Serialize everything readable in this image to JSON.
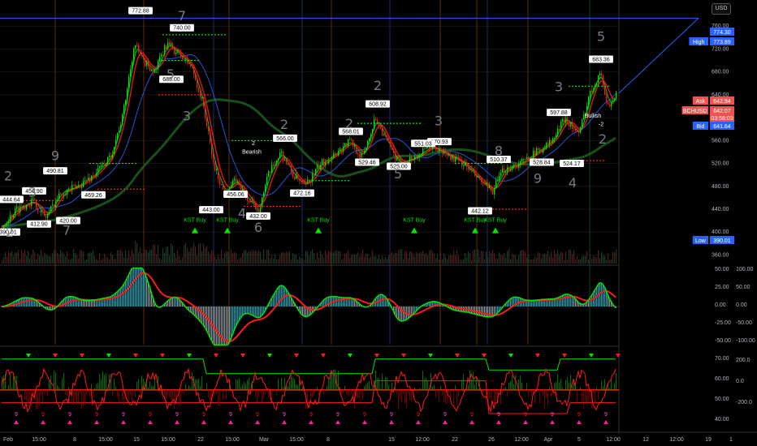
{
  "currency_button": "USD",
  "colors": {
    "bg": "#000000",
    "up": "#26a69a",
    "down": "#ef5350",
    "green": "#00e600",
    "red": "#ff1a1a",
    "blue": "#2962ff",
    "text": "#b2b5be"
  },
  "chart_data": {
    "type": "candlestick",
    "symbol": "BCHUSD",
    "price_axis": {
      "ticks": [
        "760.00",
        "720.00",
        "680.00",
        "640.00",
        "600.00",
        "560.00",
        "520.00",
        "480.00",
        "440.00",
        "400.00",
        "360.00"
      ],
      "range": [
        345,
        800
      ]
    },
    "time_axis": {
      "ticks": [
        "Feb",
        "15:00",
        "8",
        "15:00",
        "15",
        "15:00",
        "22",
        "15:00",
        "Mar",
        "15:00",
        "8",
        "15",
        "12:00",
        "22",
        "26",
        "12:00",
        "Apr",
        "5",
        "12:00",
        "12",
        "12:00",
        "19",
        "1"
      ]
    },
    "price_tags": [
      {
        "label": "",
        "value": "774.30",
        "color": "#2962ff"
      },
      {
        "label": "High",
        "value": "773.89",
        "color": "#2962ff"
      },
      {
        "label": "Ask",
        "value": "642.94",
        "color": "#ef5350"
      },
      {
        "label": "BCHUSD",
        "value": "642.07",
        "sub": "03:56:03",
        "color": "#ef5350"
      },
      {
        "label": "Bid",
        "value": "641.64",
        "color": "#2962ff"
      },
      {
        "label": "Low",
        "value": "390.01",
        "color": "#2962ff"
      }
    ],
    "pivot_labels": [
      "444.64",
      "456.90",
      "490.81",
      "412.90",
      "420.00",
      "469.26",
      "772.88",
      "740.00",
      "688.00",
      "443.00",
      "456.06",
      "432.00",
      "472.16",
      "566.00",
      "568.01",
      "570.93",
      "608.92",
      "529.46",
      "525.00",
      "551.03",
      "510.37",
      "442.12",
      "528.84",
      "597.88",
      "524.17",
      "683.36",
      "390.01"
    ],
    "count_labels": [
      "2",
      "3",
      "9",
      "7",
      "4",
      "7",
      "5",
      "3",
      "2",
      "2",
      "6",
      "2",
      "5",
      "3",
      "8",
      "9",
      "3",
      "5",
      "4",
      "2",
      "4",
      "2"
    ],
    "annotations": [
      "Bearish",
      "Bullish",
      "-2",
      "2"
    ],
    "signals": [
      "KST Buy",
      "KST Buy",
      "KST Buy",
      "KST Buy",
      "KST Buy",
      "KST Buy"
    ],
    "candles_desc": "approx daily-ish candles from 420 to 770 peak then 430 low, consolidation 500-560, rally to 683",
    "macd_axis": {
      "left": [
        "50.00",
        "25.00",
        "0.00",
        "-25.00",
        "-50.00"
      ],
      "right": [
        "100.00",
        "50.00",
        "0.00",
        "-50.00",
        "-100.00"
      ]
    },
    "osc_axis": {
      "left": [
        "70.00",
        "60.00",
        "50.00",
        "40.00"
      ],
      "right": [
        "200.0",
        "0.0",
        "-200.0"
      ]
    },
    "osc_markers": [
      "9",
      "9",
      "9",
      "9",
      "9",
      "9",
      "9",
      "9",
      "9",
      "9",
      "9",
      "9",
      "9",
      "9",
      "9",
      "9",
      "9",
      "9",
      "9",
      "9",
      "9",
      "9",
      "9"
    ]
  }
}
